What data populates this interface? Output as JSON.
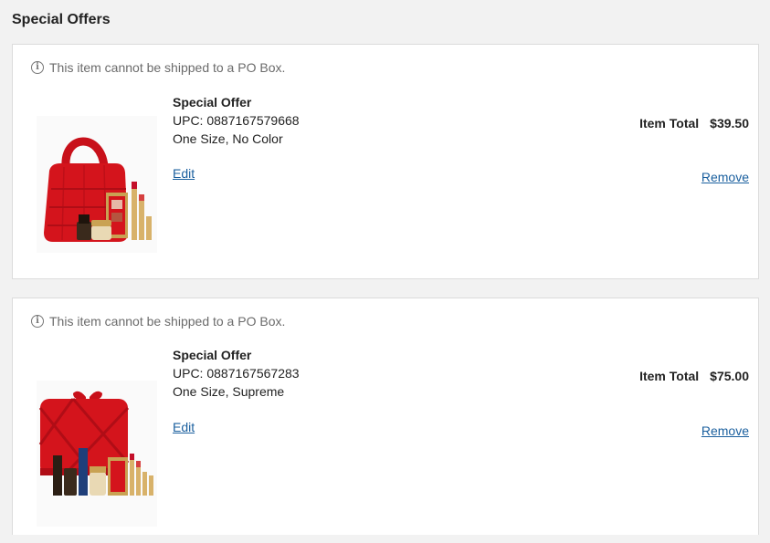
{
  "section": {
    "title": "Special Offers"
  },
  "items": [
    {
      "notice": "This item cannot be shipped to a PO Box.",
      "name": "Special Offer",
      "upc": "UPC: 0887167579668",
      "variant": "One Size, No Color",
      "edit_label": "Edit",
      "total_label": "Item Total",
      "total_value": "$39.50",
      "remove_label": "Remove"
    },
    {
      "notice": "This item cannot be shipped to a PO Box.",
      "name": "Special Offer",
      "upc": "UPC: 0887167567283",
      "variant": "One Size, Supreme",
      "edit_label": "Edit",
      "total_label": "Item Total",
      "total_value": "$75.00",
      "remove_label": "Remove"
    }
  ],
  "colors": {
    "link": "#1a5f9e",
    "product_red": "#d4141c",
    "gold": "#c9a253"
  }
}
